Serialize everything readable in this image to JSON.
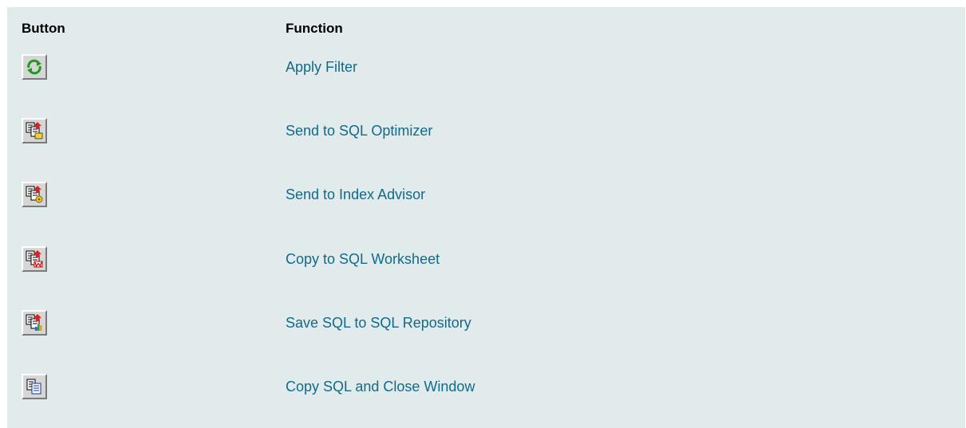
{
  "table": {
    "col_button": "Button",
    "col_function": "Function",
    "rows": [
      {
        "icon": "apply-filter-icon",
        "label": "Apply Filter"
      },
      {
        "icon": "send-to-sql-optimizer-icon",
        "label": "Send to SQL Optimizer"
      },
      {
        "icon": "send-to-index-advisor-icon",
        "label": "Send to Index Advisor"
      },
      {
        "icon": "copy-to-sql-worksheet-icon",
        "label": "Copy to SQL Worksheet"
      },
      {
        "icon": "save-sql-to-repository-icon",
        "label": "Save SQL to SQL Repository"
      },
      {
        "icon": "copy-sql-close-window-icon",
        "label": "Copy SQL and Close Window"
      }
    ]
  },
  "colors": {
    "panel_bg": "#e1ebeb",
    "link_text": "#116a8a",
    "button_face": "#d6d6d6"
  }
}
